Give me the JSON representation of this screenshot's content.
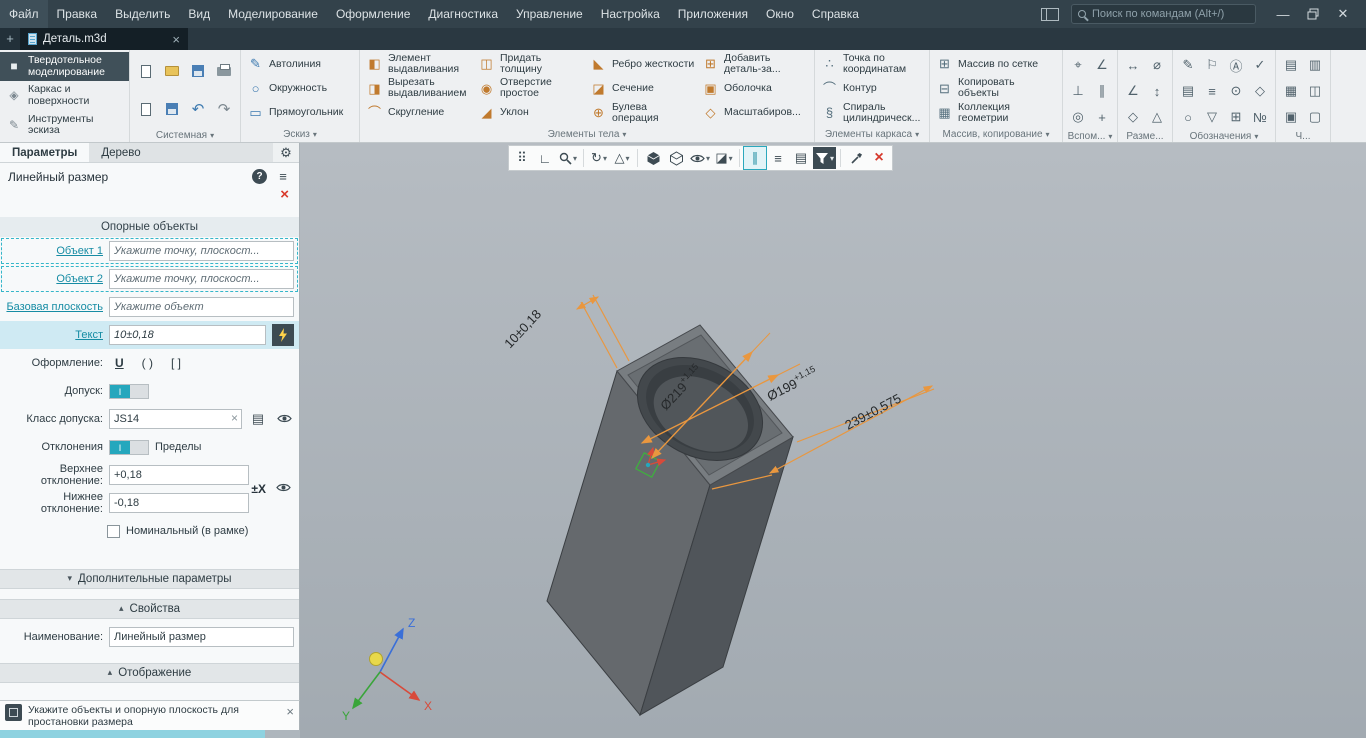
{
  "menubar": {
    "items": [
      "Файл",
      "Правка",
      "Выделить",
      "Вид",
      "Моделирование",
      "Оформление",
      "Диагностика",
      "Управление",
      "Настройка",
      "Приложения",
      "Окно",
      "Справка"
    ],
    "search_placeholder": "Поиск по командам (Alt+/)",
    "win_min": "—",
    "win_close": "✕"
  },
  "tabbar": {
    "new_tab": "+",
    "tab_title": "Деталь.m3d",
    "close": "×"
  },
  "ribbon": {
    "nav": [
      {
        "icon": "■",
        "label": "Твердотельное моделирование"
      },
      {
        "icon": "◈",
        "label": "Каркас и поверхности"
      },
      {
        "icon": "✎",
        "label": "Инструменты эскиза"
      }
    ],
    "captions": {
      "system": "Системная",
      "sketch": "Эскиз",
      "body": "Элементы тела",
      "frame": "Элементы каркаса",
      "array": "Массив, копирование",
      "aux": "Вспом...",
      "dims": "Разме...",
      "notes": "Обозначения",
      "misc": "Ч..."
    },
    "sketch_tools": [
      {
        "icon": "✎",
        "label": "Автолиния"
      },
      {
        "icon": "○",
        "label": "Окружность"
      },
      {
        "icon": "▭",
        "label": "Прямоугольник"
      }
    ],
    "body_col1": [
      {
        "icon": "◧",
        "label": "Элемент выдавливания"
      },
      {
        "icon": "◨",
        "label": "Вырезать выдавливанием"
      },
      {
        "icon": "⌒",
        "label": "Скругление"
      }
    ],
    "body_col2": [
      {
        "icon": "◫",
        "label": "Придать толщину"
      },
      {
        "icon": "◉",
        "label": "Отверстие простое"
      },
      {
        "icon": "◢",
        "label": "Уклон"
      }
    ],
    "body_col3": [
      {
        "icon": "◣",
        "label": "Ребро жесткости"
      },
      {
        "icon": "◪",
        "label": "Сечение"
      },
      {
        "icon": "⊕",
        "label": "Булева операция"
      }
    ],
    "body_col4": [
      {
        "icon": "⊞",
        "label": "Добавить деталь-за..."
      },
      {
        "icon": "▣",
        "label": "Оболочка"
      },
      {
        "icon": "◇",
        "label": "Масштабиров..."
      }
    ],
    "frame_tools": [
      {
        "icon": "∴",
        "label": "Точка по координатам"
      },
      {
        "icon": "⌒",
        "label": "Контур"
      },
      {
        "icon": "§",
        "label": "Спираль цилиндрическ..."
      }
    ],
    "array_tools": [
      {
        "icon": "⊞",
        "label": "Массив по сетке"
      },
      {
        "icon": "⊟",
        "label": "Копировать объекты"
      },
      {
        "icon": "▦",
        "label": "Коллекция геометрии"
      }
    ],
    "aux_icons": [
      "⌖",
      "∠",
      "⊥",
      "∥",
      "◎",
      "+"
    ],
    "dim_icons": [
      "↔",
      "⌀",
      "∠",
      "↕",
      "◇",
      "△"
    ],
    "note_icons": [
      "✎",
      "⚐",
      "Ⓐ",
      "✓",
      "▤",
      "≡",
      "⊙",
      "◇",
      "○",
      "▽",
      "⊞",
      "№"
    ],
    "misc_icons": [
      "▤",
      "▥",
      "▦",
      "◫",
      "▣",
      "▢"
    ]
  },
  "panel": {
    "tab_params": "Параметры",
    "tab_tree": "Дерево",
    "title": "Линейный размер",
    "section_support": "Опорные объекты",
    "object1_label": "Объект 1",
    "object1_placeholder": "Укажите точку, плоскост...",
    "object2_label": "Объект 2",
    "object2_placeholder": "Укажите точку, плоскост...",
    "base_label": "Базовая плоскость",
    "base_placeholder": "Укажите объект",
    "text_label": "Текст",
    "text_value": "10±0,18",
    "style_label": "Оформление:",
    "style_underline": "U",
    "style_paren": "( )",
    "style_bracket": "[ ]",
    "tol_label": "Допуск:",
    "toggle_on": "I",
    "tol_class_label": "Класс допуска:",
    "tol_class_value": "JS14",
    "dev_label": "Отклонения",
    "limits_label": "Пределы",
    "upper_label": "Верхнее отклонение:",
    "upper_value": "+0,18",
    "lower_label": "Нижнее отклонение:",
    "lower_value": "-0,18",
    "plusminus_icon": "±X",
    "nominal_label": "Номинальный (в рамке)",
    "more_bar": "Дополнительные параметры",
    "props_bar": "Свойства",
    "name_label": "Наименование:",
    "name_value": "Линейный размер",
    "display_bar": "Отображение"
  },
  "statusbar": {
    "message": "Укажите объекты и опорную плоскость для простановки размера",
    "close": "×"
  },
  "viewport": {
    "dim_10": "10±0,18",
    "dim_219": "Ø219",
    "dim_219_sup": "+1,15",
    "dim_199": "Ø199",
    "dim_199_sup": "+1,15",
    "dim_239": "239±0,575",
    "axis_x": "X",
    "axis_y": "Y",
    "axis_z": "Z"
  },
  "glyphs": {
    "dropdown": "▾",
    "chevron_down": "▾",
    "chevron_up": "▴",
    "undo": "↶",
    "redo": "↷",
    "grid": "⠿",
    "csys": "∟",
    "orient1": "↻",
    "orient2": "△",
    "section": "◪",
    "snap": "∥",
    "layers": "≡",
    "sheet": "▤",
    "gear": "⚙",
    "help": "?",
    "tree": "≡",
    "clear": "×",
    "redx": "×",
    "book": "▤"
  }
}
